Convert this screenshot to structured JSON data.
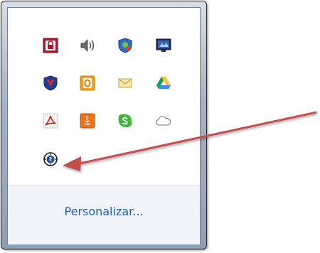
{
  "tray": {
    "customize_label": "Personalizar...",
    "icons": [
      "pdf-protect-icon",
      "volume-icon",
      "network-shield-icon",
      "display-monitor-icon",
      "mcafee-icon",
      "office-outlook-icon",
      "mail-envelope-icon",
      "google-drive-icon",
      "acrobat-reader-icon",
      "java-icon",
      "skype-icon",
      "cloud-icon",
      "sync-clock-icon"
    ]
  },
  "colors": {
    "arrow": "#c0504d",
    "link": "#1f5fb8"
  }
}
